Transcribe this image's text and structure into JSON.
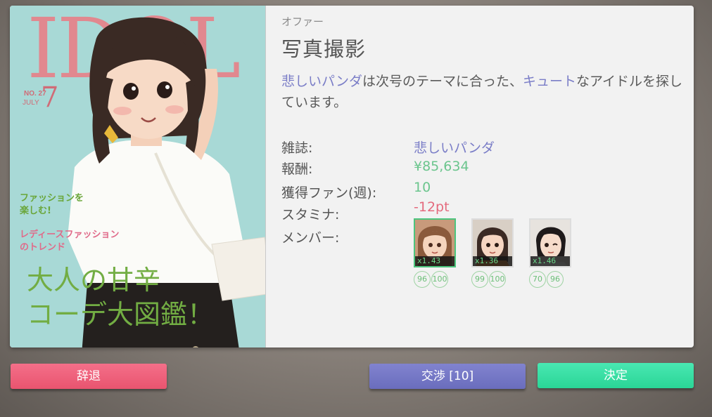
{
  "cover": {
    "masthead": "IDOL",
    "issue_number": "NO. 27",
    "issue_month": "JULY",
    "issue_big": "7",
    "copy1": "ファッションを\n楽しむ!",
    "copy2": "レディースファッション\nのトレンド",
    "headline": "大人の甘辛\nコーデ大図鑑！"
  },
  "offer": {
    "label": "オファー",
    "title": "写真撮影",
    "desc_magazine": "悲しいパンダ",
    "desc_part1": "は次号のテーマに合った、",
    "desc_theme": "キュート",
    "desc_part2": "なアイドルを探しています。"
  },
  "details": {
    "magazine_label": "雑誌:",
    "magazine_value": "悲しいパンダ",
    "reward_label": "報酬:",
    "reward_value": "¥85,634",
    "fans_label": "獲得ファン(週):",
    "fans_value": "10",
    "stamina_label": "スタミナ:",
    "stamina_value": "-12pt",
    "members_label": "メンバー:"
  },
  "members": [
    {
      "multiplier": "x1.43",
      "stat1": "96",
      "stat2": "100",
      "selected": true
    },
    {
      "multiplier": "x1.36",
      "stat1": "99",
      "stat2": "100",
      "selected": false
    },
    {
      "multiplier": "x1.46",
      "stat1": "70",
      "stat2": "96",
      "selected": false
    }
  ],
  "buttons": {
    "decline": "辞退",
    "negotiate": "交渉 [10]",
    "decide": "決定"
  },
  "colors": {
    "accent_blue": "#7a7dc7",
    "value_green": "#6bc58d",
    "value_red": "#e46a7d",
    "decline": "#ee5f7b",
    "negotiate": "#7577c6",
    "decide": "#38dea4"
  }
}
